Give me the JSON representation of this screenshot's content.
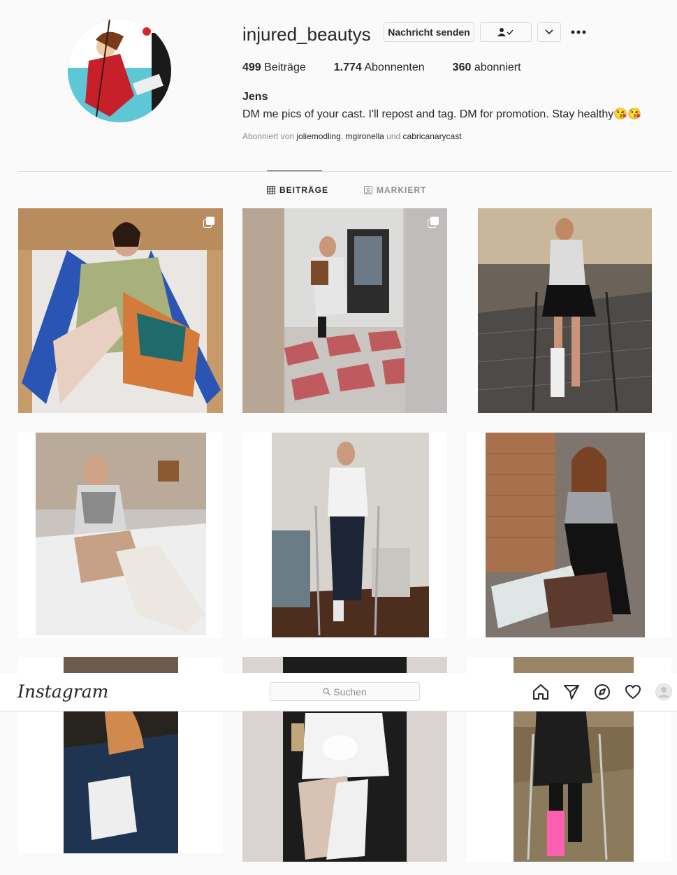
{
  "profile": {
    "username": "injured_beautys",
    "message_button": "Nachricht senden",
    "posts_count": "499",
    "posts_label": "Beiträge",
    "followers_count": "1.774",
    "followers_label": "Abonnenten",
    "following_count": "360",
    "following_label": "abonniert",
    "name": "Jens",
    "bio": "DM me pics of your cast. I'll repost and tag. DM for promotion. Stay healthy😘😘",
    "followed_by_prefix": "Abonniert von",
    "followed_by_1": "joliemodling",
    "followed_by_2": "mgironella",
    "followed_by_and": "und",
    "followed_by_3": "cabricanarycast"
  },
  "tabs": {
    "posts": "BEITRÄGE",
    "tagged": "MARKIERT"
  },
  "navbar": {
    "logo": "Instagram",
    "search_placeholder": "Suchen"
  },
  "icons": {
    "follow_status": "person-check-icon",
    "dropdown": "chevron-down-icon",
    "more": "more-horizontal-icon",
    "grid": "grid-icon",
    "tagged": "tagged-user-icon",
    "carousel": "multiple-posts-icon",
    "home": "home-icon",
    "direct": "paper-plane-icon",
    "explore": "compass-icon",
    "activity": "heart-icon",
    "avatar": "profile-avatar-icon"
  },
  "colors": {
    "background": "#fafafa",
    "text": "#262626",
    "secondary_text": "#8e8e8e",
    "border": "#dbdbdb"
  }
}
